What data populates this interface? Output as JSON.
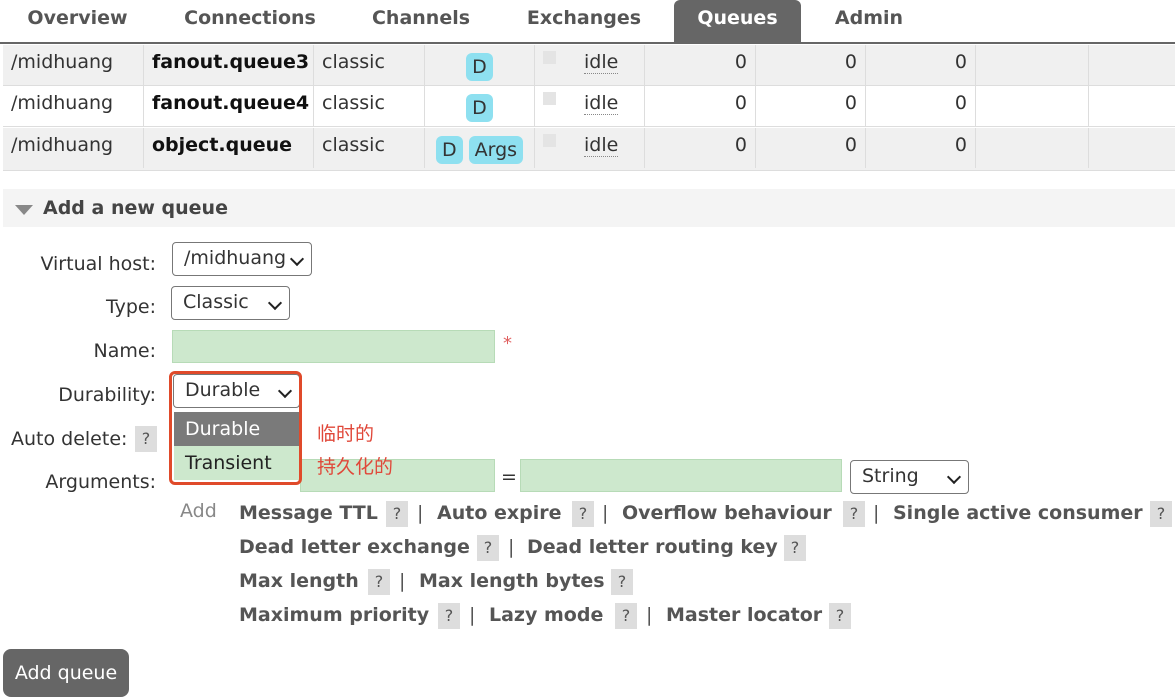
{
  "nav": {
    "tabs": [
      {
        "label": "Overview",
        "active": false
      },
      {
        "label": "Connections",
        "active": false
      },
      {
        "label": "Channels",
        "active": false
      },
      {
        "label": "Exchanges",
        "active": false
      },
      {
        "label": "Queues",
        "active": true
      },
      {
        "label": "Admin",
        "active": false
      }
    ]
  },
  "queues": [
    {
      "vhost": "/midhuang",
      "name": "fanout.queue3",
      "type": "classic",
      "features": [
        "D"
      ],
      "state": "idle",
      "ready": "0",
      "unacked": "0",
      "total": "0"
    },
    {
      "vhost": "/midhuang",
      "name": "fanout.queue4",
      "type": "classic",
      "features": [
        "D"
      ],
      "state": "idle",
      "ready": "0",
      "unacked": "0",
      "total": "0"
    },
    {
      "vhost": "/midhuang",
      "name": "object.queue",
      "type": "classic",
      "features": [
        "D",
        "Args"
      ],
      "state": "idle",
      "ready": "0",
      "unacked": "0",
      "total": "0"
    }
  ],
  "form": {
    "section_title": "Add a new queue",
    "virtual_host": {
      "label": "Virtual host:",
      "value": "/midhuang"
    },
    "type": {
      "label": "Type:",
      "value": "Classic"
    },
    "name": {
      "label": "Name:",
      "required_mark": "*"
    },
    "durability": {
      "label": "Durability:",
      "value": "Durable",
      "options": [
        "Durable",
        "Transient"
      ]
    },
    "auto_delete": {
      "label": "Auto delete:",
      "help": "?"
    },
    "arguments": {
      "label": "Arguments:",
      "equals": "=",
      "type_value": "String"
    },
    "add_label": "Add",
    "arg_links": [
      [
        "Message TTL",
        "Auto expire",
        "Overflow behaviour",
        "Single active consumer"
      ],
      [
        "Dead letter exchange",
        "Dead letter routing key"
      ],
      [
        "Max length",
        "Max length bytes"
      ],
      [
        "Maximum priority",
        "Lazy mode",
        "Master locator"
      ]
    ],
    "help": "?",
    "separator": "|",
    "submit": "Add queue"
  },
  "annotations": {
    "first": "临时的",
    "second": "持久化的"
  },
  "colors": {
    "accent": "#666666",
    "badge": "#8ee0f0",
    "field": "#cde8cd",
    "annotation": "#e0483a"
  }
}
